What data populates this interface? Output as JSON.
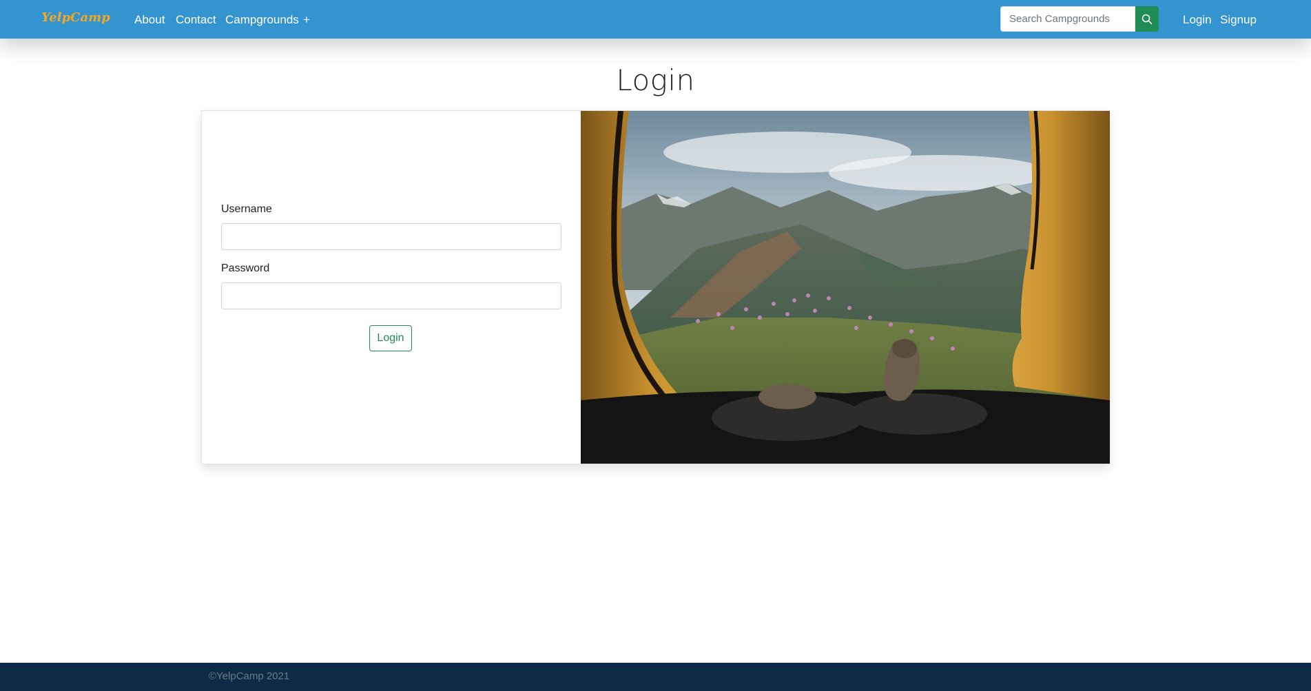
{
  "navbar": {
    "brand": "YelpCamp",
    "links": {
      "about": "About",
      "contact": "Contact",
      "campgrounds": "Campgrounds",
      "new": "+"
    },
    "search": {
      "placeholder": "Search Campgrounds",
      "icon": "search-icon"
    },
    "auth": {
      "login": "Login",
      "signup": "Signup"
    }
  },
  "page": {
    "title": "Login"
  },
  "form": {
    "username_label": "Username",
    "username_value": "",
    "password_label": "Password",
    "password_value": "",
    "submit_label": "Login"
  },
  "footer": {
    "text": "©YelpCamp 2021"
  },
  "colors": {
    "navbar": "#3394d0",
    "brand": "#f5a623",
    "accent_green": "#1f8b55",
    "footer": "#0d2b47"
  }
}
